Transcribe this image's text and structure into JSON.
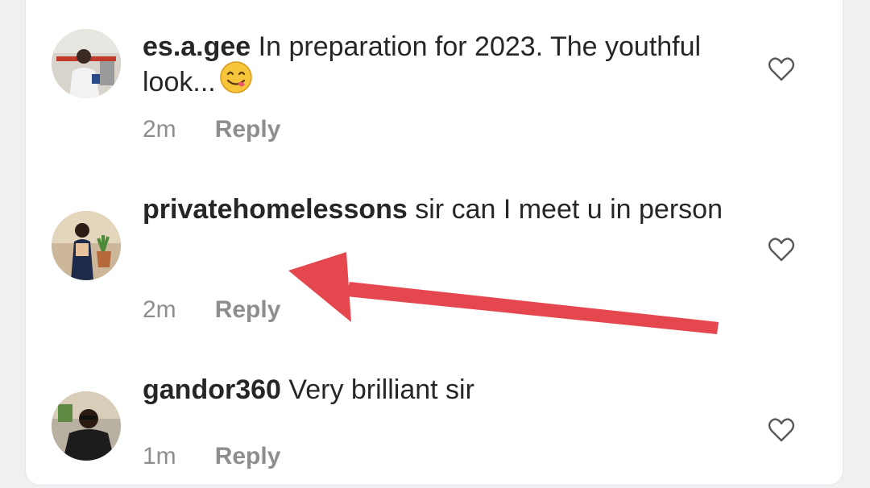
{
  "comments": [
    {
      "username": "es.a.gee",
      "text": "In preparation for 2023. The youthful look...",
      "emoji": "smiling-face-savoring-food",
      "time": "2m",
      "reply_label": "Reply"
    },
    {
      "username": "privatehomelessons",
      "text": "sir can I meet u in person",
      "time": "2m",
      "reply_label": "Reply"
    },
    {
      "username": "gandor360",
      "text": "Very brilliant sir",
      "time": "1m",
      "reply_label": "Reply"
    }
  ],
  "annotation": {
    "type": "arrow",
    "color": "#e5474f",
    "points_to": "privatehomelessons"
  },
  "colors": {
    "text": "#262626",
    "secondary": "#8e8e8e",
    "background": "#ffffff"
  }
}
